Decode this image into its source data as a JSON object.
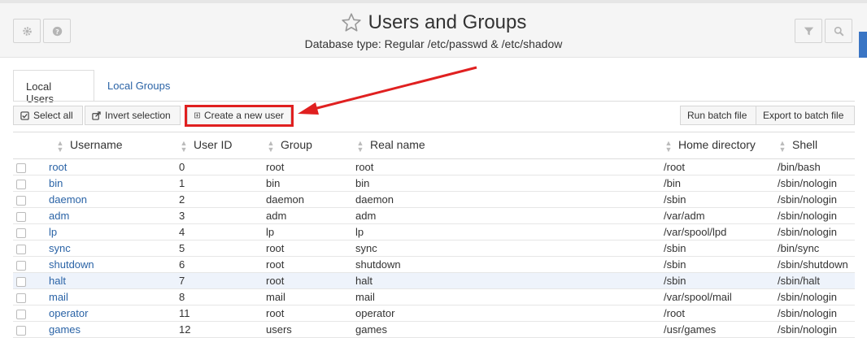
{
  "header": {
    "title": "Users and Groups",
    "subtitle": "Database type: Regular /etc/passwd & /etc/shadow",
    "icons": {
      "left": [
        "gear-icon",
        "help-icon"
      ],
      "title": "star-icon",
      "right": [
        "filter-icon",
        "search-icon"
      ]
    }
  },
  "tabs": [
    {
      "label": "Local Users",
      "active": true
    },
    {
      "label": "Local Groups",
      "active": false
    }
  ],
  "toolbar": {
    "select_all": "Select all",
    "invert_selection": "Invert selection",
    "create_user": "Create a new user",
    "run_batch": "Run batch file",
    "export_batch": "Export to batch file"
  },
  "annotation_color": "#e02020",
  "table": {
    "columns": [
      "Username",
      "User ID",
      "Group",
      "Real name",
      "Home directory",
      "Shell"
    ],
    "rows": [
      {
        "username": "root",
        "uid": "0",
        "group": "root",
        "realname": "root",
        "home": "/root",
        "shell": "/bin/bash"
      },
      {
        "username": "bin",
        "uid": "1",
        "group": "bin",
        "realname": "bin",
        "home": "/bin",
        "shell": "/sbin/nologin"
      },
      {
        "username": "daemon",
        "uid": "2",
        "group": "daemon",
        "realname": "daemon",
        "home": "/sbin",
        "shell": "/sbin/nologin"
      },
      {
        "username": "adm",
        "uid": "3",
        "group": "adm",
        "realname": "adm",
        "home": "/var/adm",
        "shell": "/sbin/nologin"
      },
      {
        "username": "lp",
        "uid": "4",
        "group": "lp",
        "realname": "lp",
        "home": "/var/spool/lpd",
        "shell": "/sbin/nologin"
      },
      {
        "username": "sync",
        "uid": "5",
        "group": "root",
        "realname": "sync",
        "home": "/sbin",
        "shell": "/bin/sync"
      },
      {
        "username": "shutdown",
        "uid": "6",
        "group": "root",
        "realname": "shutdown",
        "home": "/sbin",
        "shell": "/sbin/shutdown"
      },
      {
        "username": "halt",
        "uid": "7",
        "group": "root",
        "realname": "halt",
        "home": "/sbin",
        "shell": "/sbin/halt",
        "highlighted": true
      },
      {
        "username": "mail",
        "uid": "8",
        "group": "mail",
        "realname": "mail",
        "home": "/var/spool/mail",
        "shell": "/sbin/nologin"
      },
      {
        "username": "operator",
        "uid": "11",
        "group": "root",
        "realname": "operator",
        "home": "/root",
        "shell": "/sbin/nologin"
      },
      {
        "username": "games",
        "uid": "12",
        "group": "users",
        "realname": "games",
        "home": "/usr/games",
        "shell": "/sbin/nologin"
      }
    ]
  }
}
